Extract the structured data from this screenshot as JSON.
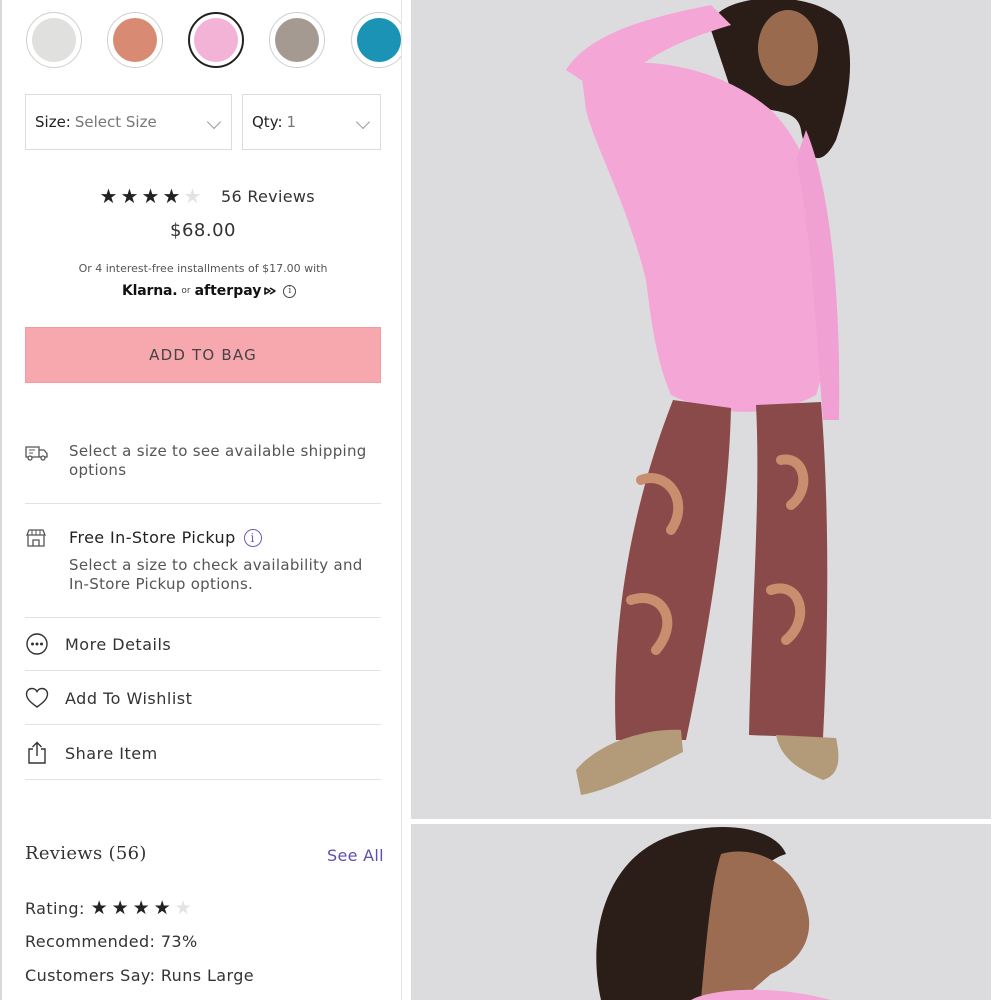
{
  "colors": {
    "accent": "#f6a8ae",
    "link": "#5b4fb0",
    "swatches": [
      "#e0e0df",
      "#d98a72",
      "#f2b3d7",
      "#a49a92",
      "#1a93b5"
    ]
  },
  "swatches": [
    {
      "name": "light-gray",
      "selected": false
    },
    {
      "name": "terracotta",
      "selected": false
    },
    {
      "name": "pink",
      "selected": true
    },
    {
      "name": "taupe",
      "selected": false
    },
    {
      "name": "teal",
      "selected": false
    }
  ],
  "size_select": {
    "label": "Size:",
    "value": "Select Size"
  },
  "qty_select": {
    "label": "Qty:",
    "value": "1"
  },
  "rating": {
    "stars": 4,
    "max": 5,
    "reviews_label": "56 Reviews"
  },
  "price": "$68.00",
  "installments": "Or 4 interest-free installments of $17.00 with",
  "payment": {
    "klarna": "Klarna.",
    "or": "or",
    "afterpay": "afterpay"
  },
  "add_to_bag": "ADD TO BAG",
  "shipping": {
    "text": "Select a size to see available shipping options",
    "icon": "delivery-truck-icon"
  },
  "pickup": {
    "title": "Free In-Store Pickup",
    "text": "Select a size to check availability and In-Store Pickup options.",
    "icon": "store-icon"
  },
  "actions": [
    {
      "label": "More Details",
      "icon": "more-dots-icon"
    },
    {
      "label": "Add To Wishlist",
      "icon": "heart-icon"
    },
    {
      "label": "Share Item",
      "icon": "share-icon"
    }
  ],
  "reviews": {
    "title": "Reviews (56)",
    "see_all": "See All",
    "rating_label": "Rating:",
    "recommended": "Recommended: 73%",
    "customers_say": "Customers Say: Runs Large"
  }
}
